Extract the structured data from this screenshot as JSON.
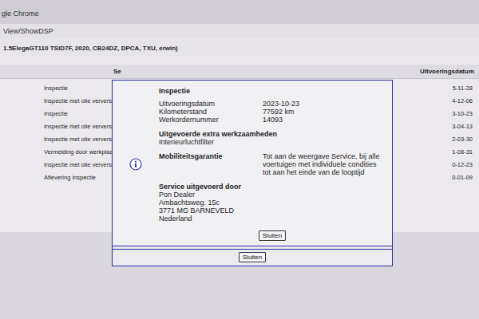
{
  "browser": {
    "title": "gle Chrome",
    "url": "View/ShowDSP",
    "vehicle": "1.5ElegaGT110 TSID7F, 2020, CB24DZ, DPCA, TXU, erwin)"
  },
  "table": {
    "columns": [
      {
        "label": "Se"
      },
      {
        "label": "Uitvoeringsdatum"
      }
    ],
    "rows": [
      {
        "service": "Inspectie",
        "date": "5-11-28"
      },
      {
        "service": "Inspectie met olie verversen (va",
        "date": "4-12-06"
      },
      {
        "service": "Inspectie",
        "date": "3-10-23"
      },
      {
        "service": "Inspectie met olie verversen (va",
        "date": "3-04-13"
      },
      {
        "service": "Inspectie met olie verversen (va",
        "date": "2-03-30"
      },
      {
        "service": "Vermelding door werkplaats",
        "date": "1-08-31"
      },
      {
        "service": "Inspectie met olie verversen (va",
        "date": "0-12-23"
      },
      {
        "service": "Aflevering inspectie",
        "date": "0-01-09"
      }
    ]
  },
  "dialog": {
    "title": "Inspectie",
    "fields": [
      {
        "label": "Uitvoeringsdatum",
        "value": "2023-10-23"
      },
      {
        "label": "Kilometerstand",
        "value": "77592 km"
      },
      {
        "label": "Werkordernummer",
        "value": "14093"
      }
    ],
    "sections": [
      {
        "kind": "stacked",
        "heading": "Uitgevoerde extra werkzaamheden",
        "lines": [
          "Interieurluchtfilter"
        ]
      },
      {
        "kind": "inline",
        "heading": "Mobiliteitsgarantie",
        "lines": [
          "Tot aan de weergave Service, bij alle voertuigen met individuele condities tot aan het einde van de looptijd"
        ]
      },
      {
        "kind": "stacked",
        "heading": "Service uitgevoerd door",
        "lines": [
          "Pon Dealer",
          "Ambachtsweg. 15c",
          "3771 MG BARNEVELD",
          "Nederland"
        ]
      }
    ],
    "buttons": [
      "Sluiten"
    ],
    "footer_buttons": [
      "Sluiten"
    ]
  }
}
